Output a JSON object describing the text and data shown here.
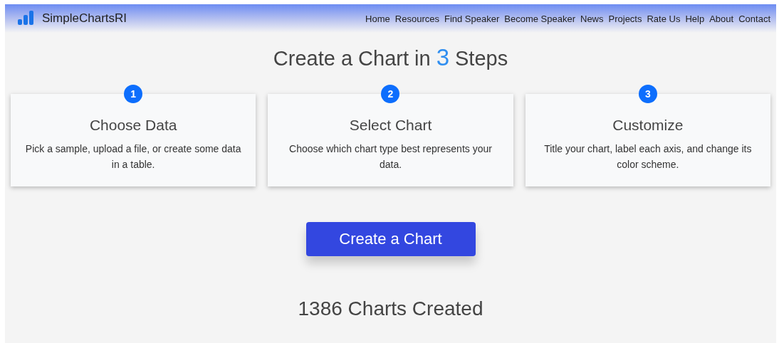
{
  "navbar": {
    "brand": "SimpleChartsRI",
    "links": [
      "Home",
      "Resources",
      "Find Speaker",
      "Become Speaker",
      "News",
      "Projects",
      "Rate Us",
      "Help",
      "About",
      "Contact"
    ]
  },
  "heading": {
    "before": "Create a Chart in",
    "number": "3",
    "after": "Steps"
  },
  "steps": [
    {
      "number": "1",
      "title": "Choose Data",
      "text": "Pick a sample, upload a file, or create some data in a table."
    },
    {
      "number": "2",
      "title": "Select Chart",
      "text": "Choose which chart type best represents your data."
    },
    {
      "number": "3",
      "title": "Customize",
      "text": "Title your chart, label each axis, and change its color scheme."
    }
  ],
  "cta_button": "Create a Chart",
  "counter": "1386 Charts Created"
}
